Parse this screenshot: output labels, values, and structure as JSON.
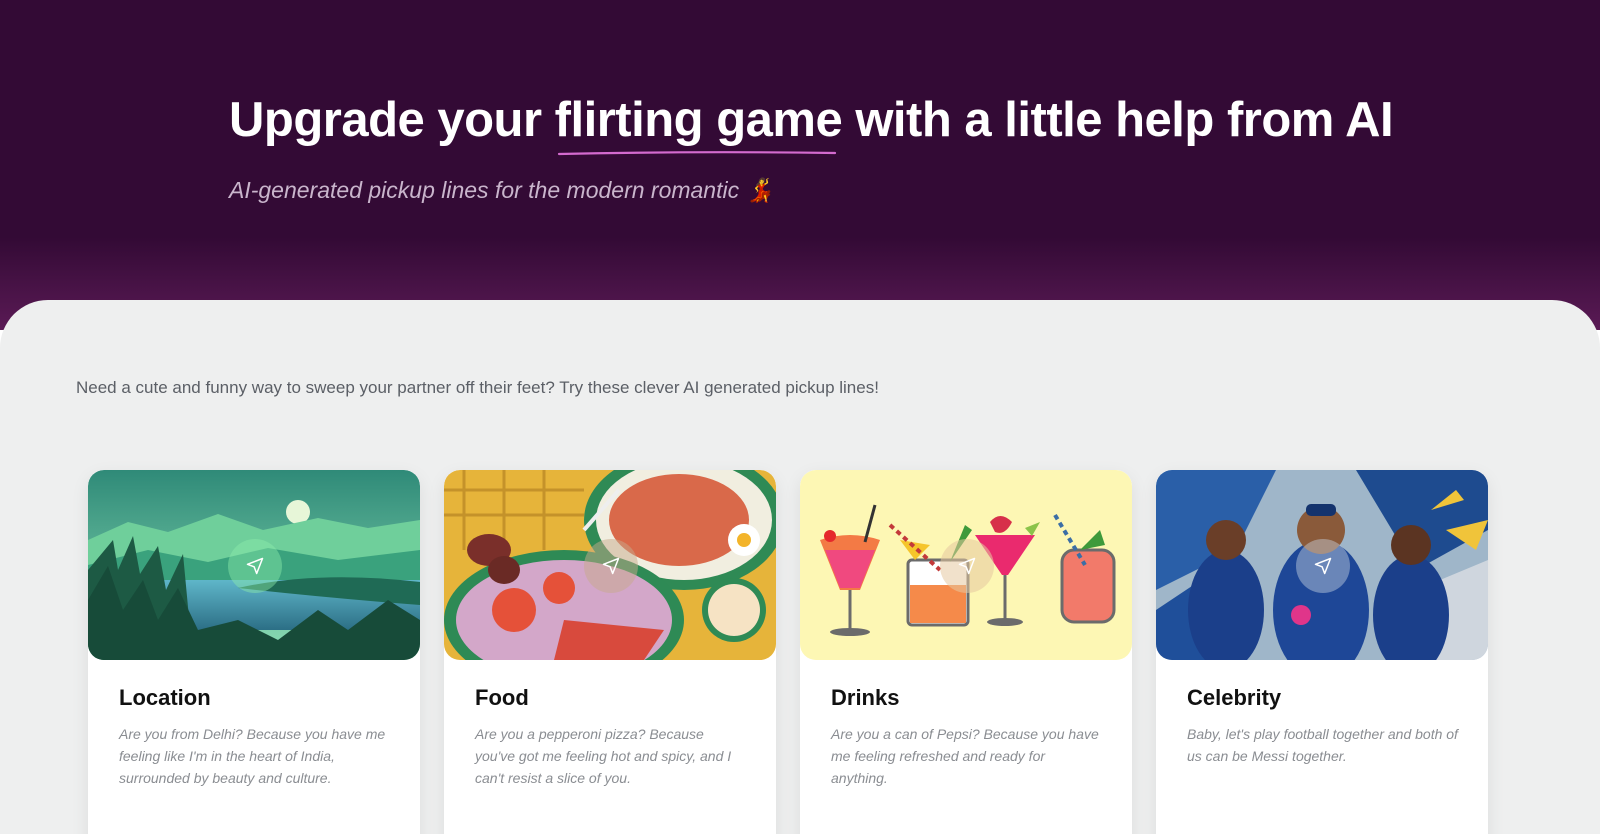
{
  "hero": {
    "title_pre": "Upgrade your ",
    "title_highlight": "flirting game",
    "title_post": " with a little help from AI",
    "subtitle": "AI-generated pickup lines for the modern romantic 💃"
  },
  "intro": "Need a cute and funny way to sweep your partner off their feet? Try these clever AI generated pickup lines!",
  "cards": [
    {
      "title": "Location",
      "text": "Are you from Delhi? Because you have me feeling like I'm in the heart of India, surrounded by beauty and culture."
    },
    {
      "title": "Food",
      "text": "Are you a pepperoni pizza? Because you've got me feeling hot and spicy, and I can't resist a slice of you."
    },
    {
      "title": "Drinks",
      "text": "Are you a can of Pepsi? Because you have me feeling refreshed and ready for anything."
    },
    {
      "title": "Celebrity",
      "text": "Baby, let's play football together and both of us can be Messi together."
    }
  ],
  "colors": {
    "hero_bg": "#330a35",
    "underline": "#d46bcf",
    "content_bg": "#eeefef"
  },
  "icons": [
    "send-icon"
  ]
}
